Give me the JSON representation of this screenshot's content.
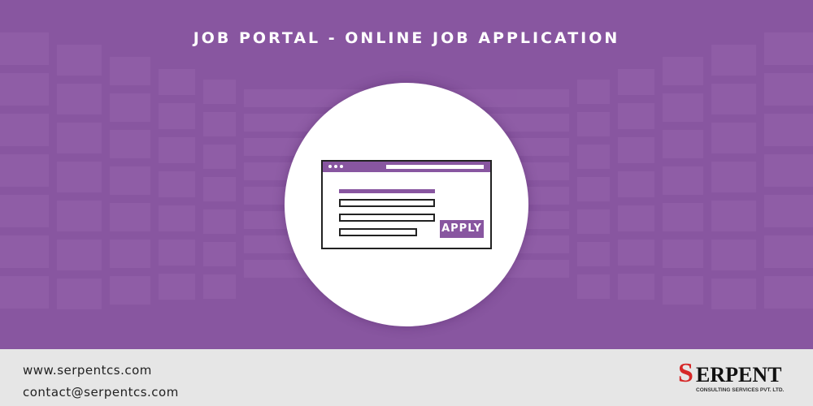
{
  "header": {
    "title": "JOB PORTAL - ONLINE JOB APPLICATION"
  },
  "illustration": {
    "apply_label": "APPLY"
  },
  "footer": {
    "website": "www.serpentcs.com",
    "email": "contact@serpentcs.com",
    "logo_text": "SERPENT",
    "logo_subtext": "CONSULTING SERVICES PVT. LTD."
  },
  "colors": {
    "brand_purple": "#8856a0",
    "footer_bg": "#e6e6e6",
    "logo_red": "#d62828"
  },
  "icons": [
    "browser-window-icon"
  ]
}
